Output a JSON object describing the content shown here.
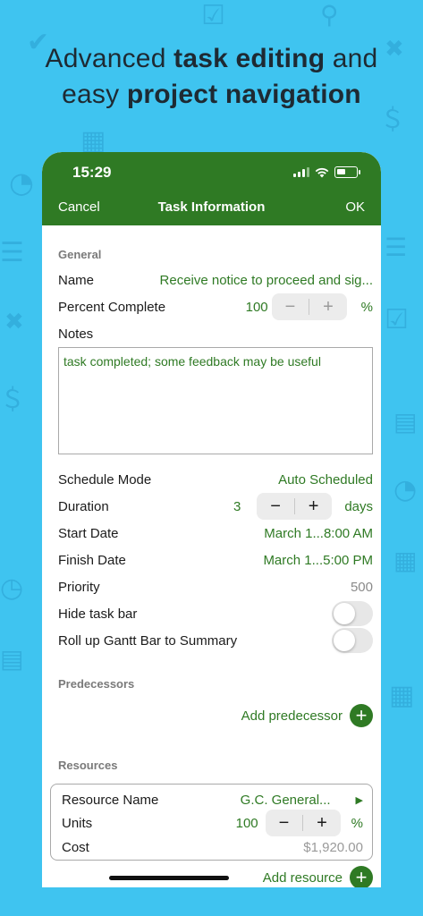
{
  "headline": {
    "line1_normal": "Advanced ",
    "line1_bold": "task editing",
    "line1_tail": " and",
    "line2_normal": "easy ",
    "line2_bold": "project navigation"
  },
  "status_bar": {
    "time": "15:29"
  },
  "nav": {
    "cancel": "Cancel",
    "title": "Task Information",
    "ok": "OK"
  },
  "general": {
    "header": "General",
    "name_label": "Name",
    "name_value": "Receive notice to proceed and sig...",
    "percent_label": "Percent Complete",
    "percent_value": "100",
    "percent_unit": "%",
    "notes_label": "Notes",
    "notes_value": "task completed; some feedback may be useful",
    "schedule_mode_label": "Schedule Mode",
    "schedule_mode_value": "Auto Scheduled",
    "duration_label": "Duration",
    "duration_value": "3",
    "duration_unit": "days",
    "start_label": "Start Date",
    "start_value": "March 1...8:00 AM",
    "finish_label": "Finish Date",
    "finish_value": "March 1...5:00 PM",
    "priority_label": "Priority",
    "priority_value": "500",
    "hide_bar_label": "Hide task bar",
    "rollup_label": "Roll up Gantt Bar to Summary"
  },
  "predecessors": {
    "header": "Predecessors",
    "add_label": "Add predecessor"
  },
  "resources": {
    "header": "Resources",
    "name_label": "Resource Name",
    "name_value": "G.C. General...",
    "units_label": "Units",
    "units_value": "100",
    "units_unit": "%",
    "cost_label": "Cost",
    "cost_value": "$1,920.00",
    "add_label": "Add resource"
  },
  "stepper": {
    "minus": "−",
    "plus": "+"
  },
  "colors": {
    "accent": "#2f7a24",
    "background": "#3fc4f0"
  }
}
